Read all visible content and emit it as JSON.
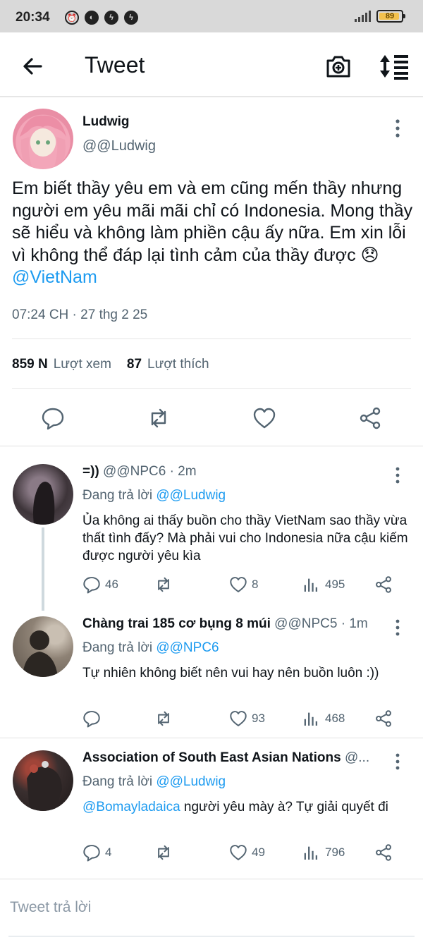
{
  "status_bar": {
    "time": "20:34",
    "battery": "89"
  },
  "header": {
    "title": "Tweet"
  },
  "main_tweet": {
    "author_name": "Ludwig",
    "author_handle": "@@Ludwig",
    "text": "Em biết thầy yêu em và em cũng mến thầy nhưng người em yêu mãi mãi chỉ có Indonesia. Mong thầy sẽ hiểu và không làm phiền cậu ấy nữa.  Em xin lỗi vì không thể đáp lại tình cảm của thầy được",
    "emoji": "😞",
    "mention": "@VietNam",
    "timestamp": "07:24 CH · 27 thg 2 25",
    "views_count": "859 N",
    "views_label": "Lượt xem",
    "likes_count": "87",
    "likes_label": "Lượt thích"
  },
  "replies": [
    {
      "name": "=))",
      "handle_time": "@@NPC6 · 2m",
      "replying_label": "Đang trả lời",
      "replying_to": "@@Ludwig",
      "mention": "",
      "text": "Ủa không ai thấy buồn cho thầy VietNam sao thầy vừa thất tình đấy?  Mà phải vui cho Indonesia nữa cậu kiếm được người yêu kìa",
      "replies": "46",
      "retweets": "",
      "likes": "8",
      "views": "495"
    },
    {
      "name": "Chàng trai 185 cơ bụng 8 múi",
      "handle_time": "@@NPC5 · 1m",
      "replying_label": "Đang trả lời",
      "replying_to": "@@NPC6",
      "mention": "",
      "text": "Tự nhiên không biết nên vui hay nên buồn luôn :))",
      "replies": "",
      "retweets": "",
      "likes": "93",
      "views": "468"
    },
    {
      "name": "Association of South East Asian Nations",
      "handle_time": "@...",
      "replying_label": "Đang trả lời",
      "replying_to": "@@Ludwig",
      "mention": "@Bomayladaica",
      "text": " người yêu mày à?  Tự giải quyết đi",
      "replies": "4",
      "retweets": "",
      "likes": "49",
      "views": "796"
    }
  ],
  "compose": {
    "placeholder": "Tweet trả lời"
  },
  "colors": {
    "accent": "#1d9bf0",
    "text": "#0f1419",
    "muted": "#536471"
  }
}
